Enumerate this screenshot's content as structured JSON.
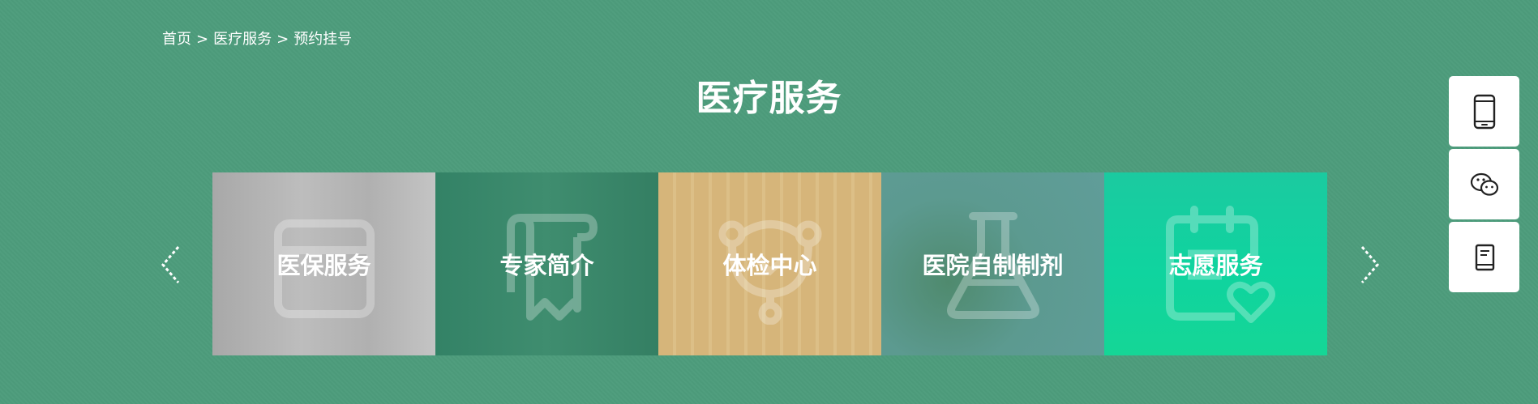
{
  "breadcrumb": {
    "items": [
      "首页",
      "医疗服务",
      "预约挂号"
    ],
    "separator": ">"
  },
  "page_title": "医疗服务",
  "carousel": {
    "cards": [
      {
        "label": "医保服务",
        "icon": "calendar-icon",
        "color": "#b3b3b3"
      },
      {
        "label": "专家简介",
        "icon": "scroll-certificate-icon",
        "color": "#3d8a6c"
      },
      {
        "label": "体检中心",
        "icon": "stethoscope-icon",
        "color": "#d9b97d"
      },
      {
        "label": "医院自制制剂",
        "icon": "flask-icon",
        "color": "#5c9a90"
      },
      {
        "label": "志愿服务",
        "icon": "clipboard-heart-icon",
        "color": "#13d19e"
      }
    ]
  },
  "side_toolbar": {
    "buttons": [
      {
        "icon": "mobile-phone-icon"
      },
      {
        "icon": "wechat-icon"
      },
      {
        "icon": "book-icon"
      }
    ]
  },
  "colors": {
    "background": "#4d9c7c",
    "text": "#ffffff",
    "toolbar_bg": "#ffffff"
  }
}
